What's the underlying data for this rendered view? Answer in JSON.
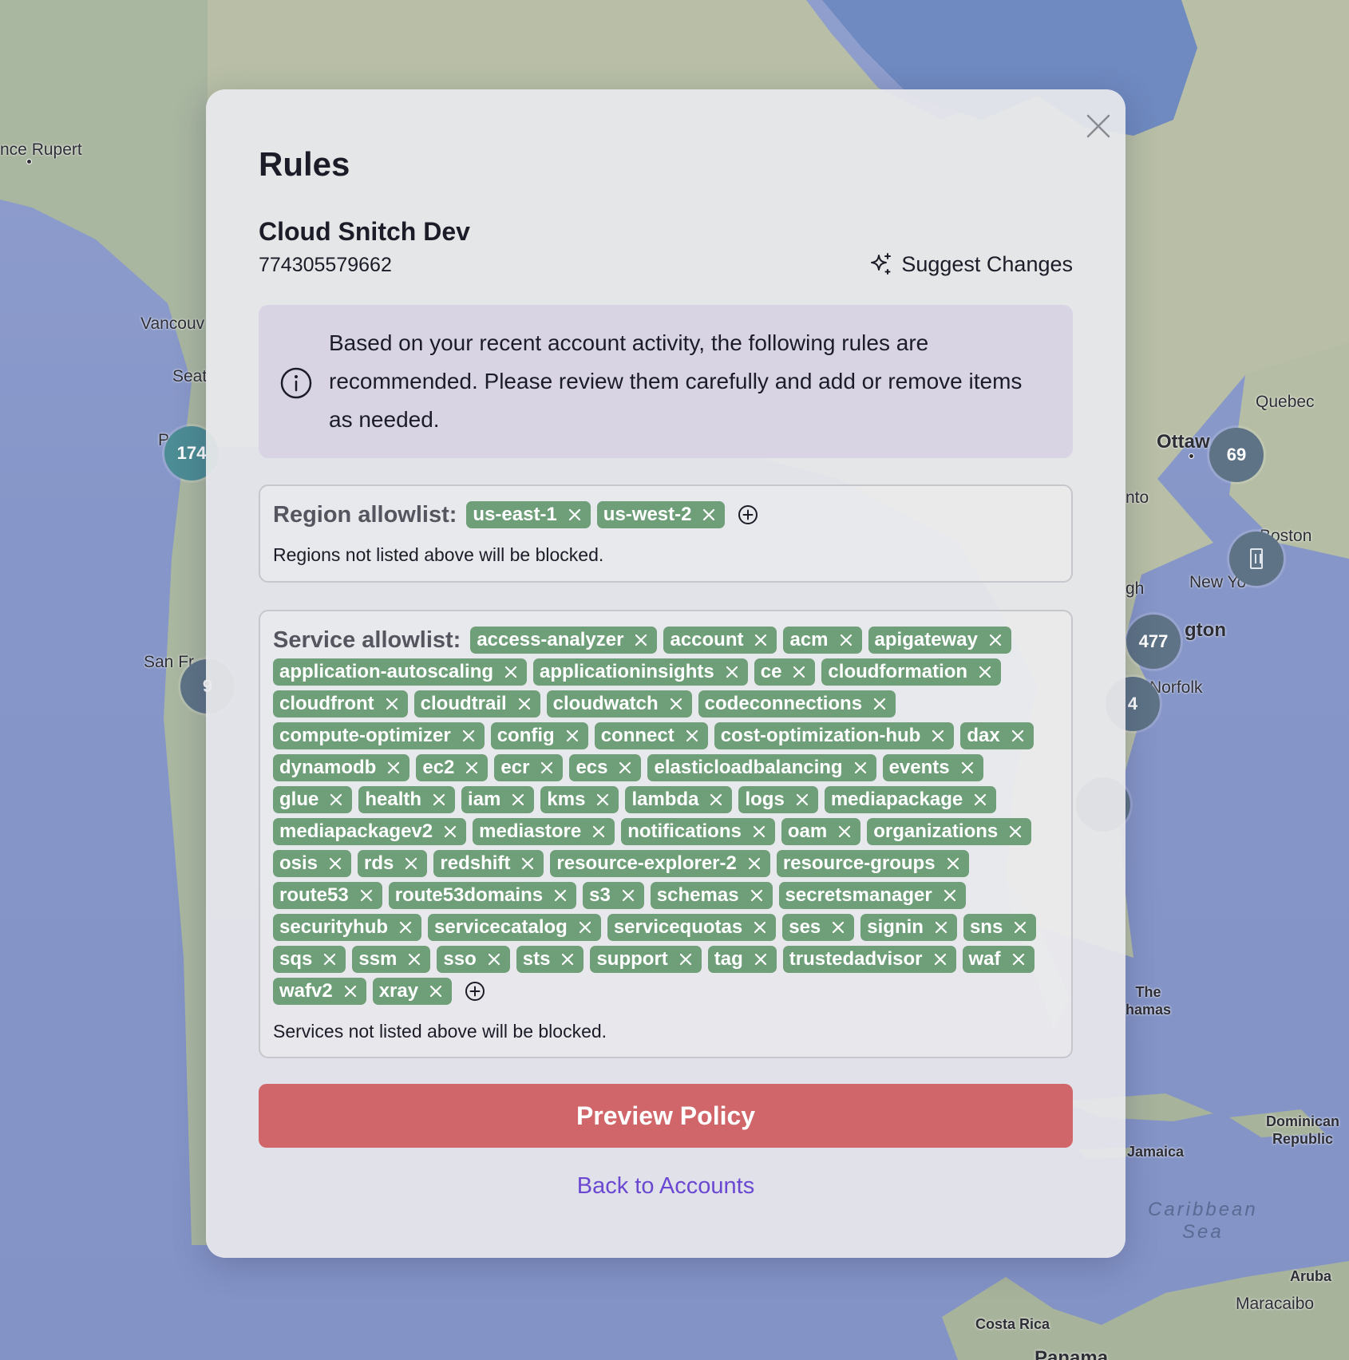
{
  "map": {
    "labels": {
      "prince_rupert": "nce Rupert",
      "vancouver": "Vancouv",
      "seattle": "Seat",
      "portland": "P",
      "san_francisco": "San Fr",
      "ottawa": "Ottaw",
      "quebec": "Quebec",
      "toronto": "nto",
      "boston": "Boston",
      "new_york": "New Yo",
      "raleigh": "gh",
      "washington": "gton",
      "norfolk": "Norfolk",
      "bahamas": "The\nhamas",
      "dominican_republic": "Dominican\nRepublic",
      "jamaica": "Jamaica",
      "caribbean_sea": "Caribbean\nSea",
      "aruba": "Aruba",
      "maracaibo": "Maracaibo",
      "costa_rica": "Costa Rica",
      "panama": "Panama"
    },
    "clusters": {
      "portland": "174",
      "ottawa": "69",
      "washington": "477",
      "norfolk": "4",
      "sf": "9"
    }
  },
  "modal": {
    "title": "Rules",
    "account_name": "Cloud Snitch Dev",
    "account_id": "774305579662",
    "suggest_label": "Suggest Changes",
    "info_text": "Based on your recent account activity, the following rules are recommended. Please review them carefully and add or remove items as needed.",
    "region": {
      "label": "Region allowlist:",
      "items": [
        "us-east-1",
        "us-west-2"
      ],
      "note": "Regions not listed above will be blocked."
    },
    "service": {
      "label": "Service allowlist:",
      "items": [
        "access-analyzer",
        "account",
        "acm",
        "apigateway",
        "application-autoscaling",
        "applicationinsights",
        "ce",
        "cloudformation",
        "cloudfront",
        "cloudtrail",
        "cloudwatch",
        "codeconnections",
        "compute-optimizer",
        "config",
        "connect",
        "cost-optimization-hub",
        "dax",
        "dynamodb",
        "ec2",
        "ecr",
        "ecs",
        "elasticloadbalancing",
        "events",
        "glue",
        "health",
        "iam",
        "kms",
        "lambda",
        "logs",
        "mediapackage",
        "mediapackagev2",
        "mediastore",
        "notifications",
        "oam",
        "organizations",
        "osis",
        "rds",
        "redshift",
        "resource-explorer-2",
        "resource-groups",
        "route53",
        "route53domains",
        "s3",
        "schemas",
        "secretsmanager",
        "securityhub",
        "servicecatalog",
        "servicequotas",
        "ses",
        "signin",
        "sns",
        "sqs",
        "ssm",
        "sso",
        "sts",
        "support",
        "tag",
        "trustedadvisor",
        "waf",
        "wafv2",
        "xray"
      ],
      "note": "Services not listed above will be blocked."
    },
    "preview_label": "Preview Policy",
    "back_label": "Back to Accounts"
  },
  "colors": {
    "chip": "#6e9f79",
    "primary_button": "#d1666a",
    "link": "#6b48d1",
    "info_bg": "#d8d4e4"
  },
  "icons": {
    "close": "close-icon",
    "sparkle": "sparkle-icon",
    "info": "info-icon",
    "chip_remove": "x-icon",
    "add": "plus-circle-icon"
  }
}
